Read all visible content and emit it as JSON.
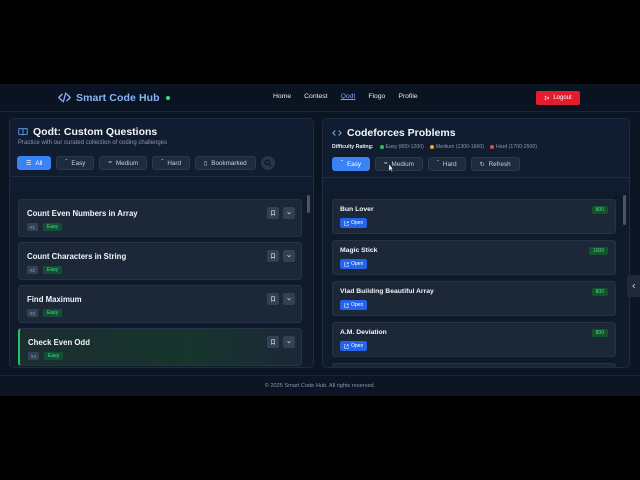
{
  "brand": {
    "name": "Smart Code Hub"
  },
  "nav": {
    "links": [
      {
        "label": "Home"
      },
      {
        "label": "Contest"
      },
      {
        "label": "Qodt"
      },
      {
        "label": "Flogo"
      },
      {
        "label": "Profile"
      }
    ],
    "active": "Qodt",
    "logout_label": "Logout"
  },
  "qodt": {
    "title": "Qodt: Custom Questions",
    "subtitle": "Practice with our curated collection of coding challenges",
    "filters": [
      {
        "label": "All",
        "active": true
      },
      {
        "label": "Easy"
      },
      {
        "label": "Medium"
      },
      {
        "label": "Hard"
      },
      {
        "label": "Bookmarked"
      }
    ],
    "questions": [
      {
        "title": "Count Even Numbers in Array",
        "num": "#1",
        "difficulty": "Easy"
      },
      {
        "title": "Count Characters in String",
        "num": "#2",
        "difficulty": "Easy"
      },
      {
        "title": "Find Maximum",
        "num": "#3",
        "difficulty": "Easy"
      },
      {
        "title": "Check Even Odd",
        "num": "#4",
        "difficulty": "Easy"
      }
    ]
  },
  "codeforces": {
    "title": "Codeforces Problems",
    "rating_label": "Difficulty Rating:",
    "legend": [
      {
        "label": "Easy (800-1200)",
        "color": "#22c55e"
      },
      {
        "label": "Medium (1300-1600)",
        "color": "#eab308"
      },
      {
        "label": "Hard (1700-2500)",
        "color": "#ef4444"
      }
    ],
    "filters": [
      {
        "label": "Easy",
        "active": true
      },
      {
        "label": "Medium"
      },
      {
        "label": "Hard"
      },
      {
        "label": "Refresh"
      }
    ],
    "open_label": "Open",
    "problems": [
      {
        "title": "Bun Lover",
        "rating": "800"
      },
      {
        "title": "Magic Stick",
        "rating": "1000"
      },
      {
        "title": "Vlad Building Beautiful Array",
        "rating": "800"
      },
      {
        "title": "A.M. Deviation",
        "rating": "800"
      }
    ]
  },
  "footer": {
    "text": "© 2025 Smart Code Hub. All rights reserved."
  },
  "colors": {
    "accent": "#3b82f6",
    "logout": "#e11d2e",
    "easy": "#22c55e"
  }
}
